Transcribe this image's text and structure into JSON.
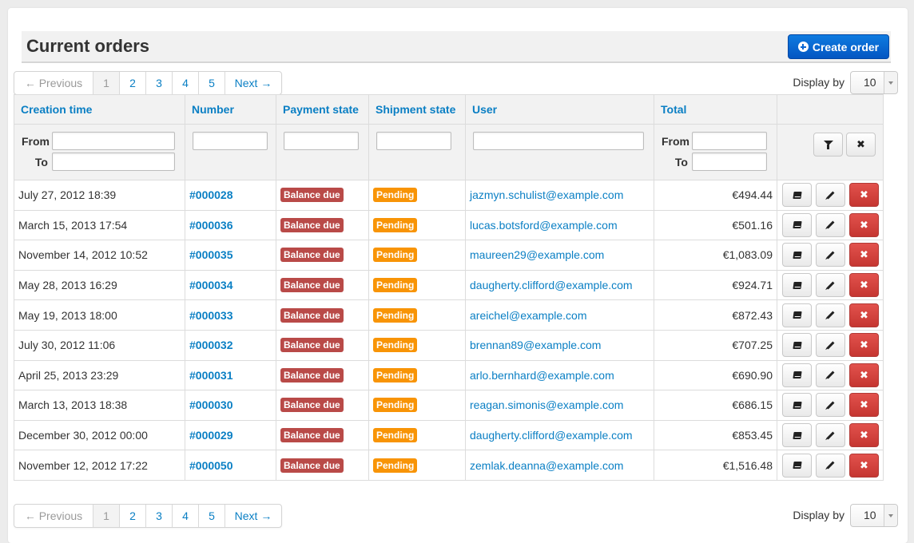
{
  "page": {
    "title": "Current orders",
    "create_label": "Create order"
  },
  "pagination": {
    "prev": "← Previous",
    "pages": [
      "1",
      "2",
      "3",
      "4",
      "5"
    ],
    "current": "1",
    "next": "Next →"
  },
  "display": {
    "label": "Display by",
    "value": "10"
  },
  "table": {
    "columns": {
      "creation_time": "Creation time",
      "number": "Number",
      "payment_state": "Payment state",
      "shipment_state": "Shipment state",
      "user": "User",
      "total": "Total"
    },
    "filters": {
      "from_label": "From",
      "to_label": "To"
    },
    "rows": [
      {
        "time": "July 27, 2012 18:39",
        "number": "#000028",
        "payment": "Balance due",
        "shipment": "Pending",
        "user": "jazmyn.schulist@example.com",
        "total": "€494.44"
      },
      {
        "time": "March 15, 2013 17:54",
        "number": "#000036",
        "payment": "Balance due",
        "shipment": "Pending",
        "user": "lucas.botsford@example.com",
        "total": "€501.16"
      },
      {
        "time": "November 14, 2012 10:52",
        "number": "#000035",
        "payment": "Balance due",
        "shipment": "Pending",
        "user": "maureen29@example.com",
        "total": "€1,083.09"
      },
      {
        "time": "May 28, 2013 16:29",
        "number": "#000034",
        "payment": "Balance due",
        "shipment": "Pending",
        "user": "daugherty.clifford@example.com",
        "total": "€924.71"
      },
      {
        "time": "May 19, 2013 18:00",
        "number": "#000033",
        "payment": "Balance due",
        "shipment": "Pending",
        "user": "areichel@example.com",
        "total": "€872.43"
      },
      {
        "time": "July 30, 2012 11:06",
        "number": "#000032",
        "payment": "Balance due",
        "shipment": "Pending",
        "user": "brennan89@example.com",
        "total": "€707.25"
      },
      {
        "time": "April 25, 2013 23:29",
        "number": "#000031",
        "payment": "Balance due",
        "shipment": "Pending",
        "user": "arlo.bernhard@example.com",
        "total": "€690.90"
      },
      {
        "time": "March 13, 2013 18:38",
        "number": "#000030",
        "payment": "Balance due",
        "shipment": "Pending",
        "user": "reagan.simonis@example.com",
        "total": "€686.15"
      },
      {
        "time": "December 30, 2012 00:00",
        "number": "#000029",
        "payment": "Balance due",
        "shipment": "Pending",
        "user": "daugherty.clifford@example.com",
        "total": "€853.45"
      },
      {
        "time": "November 12, 2012 17:22",
        "number": "#000050",
        "payment": "Balance due",
        "shipment": "Pending",
        "user": "zemlak.deanna@example.com",
        "total": "€1,516.48"
      }
    ]
  },
  "icons": {
    "create": "plus-circle-icon",
    "filter": "filter-icon",
    "clear": "close-icon",
    "show": "book-icon",
    "edit": "pencil-icon",
    "delete": "close-icon"
  },
  "colors": {
    "link": "#0a7fc4",
    "primary": "#0a67d4",
    "danger_badge": "#b94a48",
    "warning_badge": "#f89406",
    "danger_button": "#d2423d"
  }
}
